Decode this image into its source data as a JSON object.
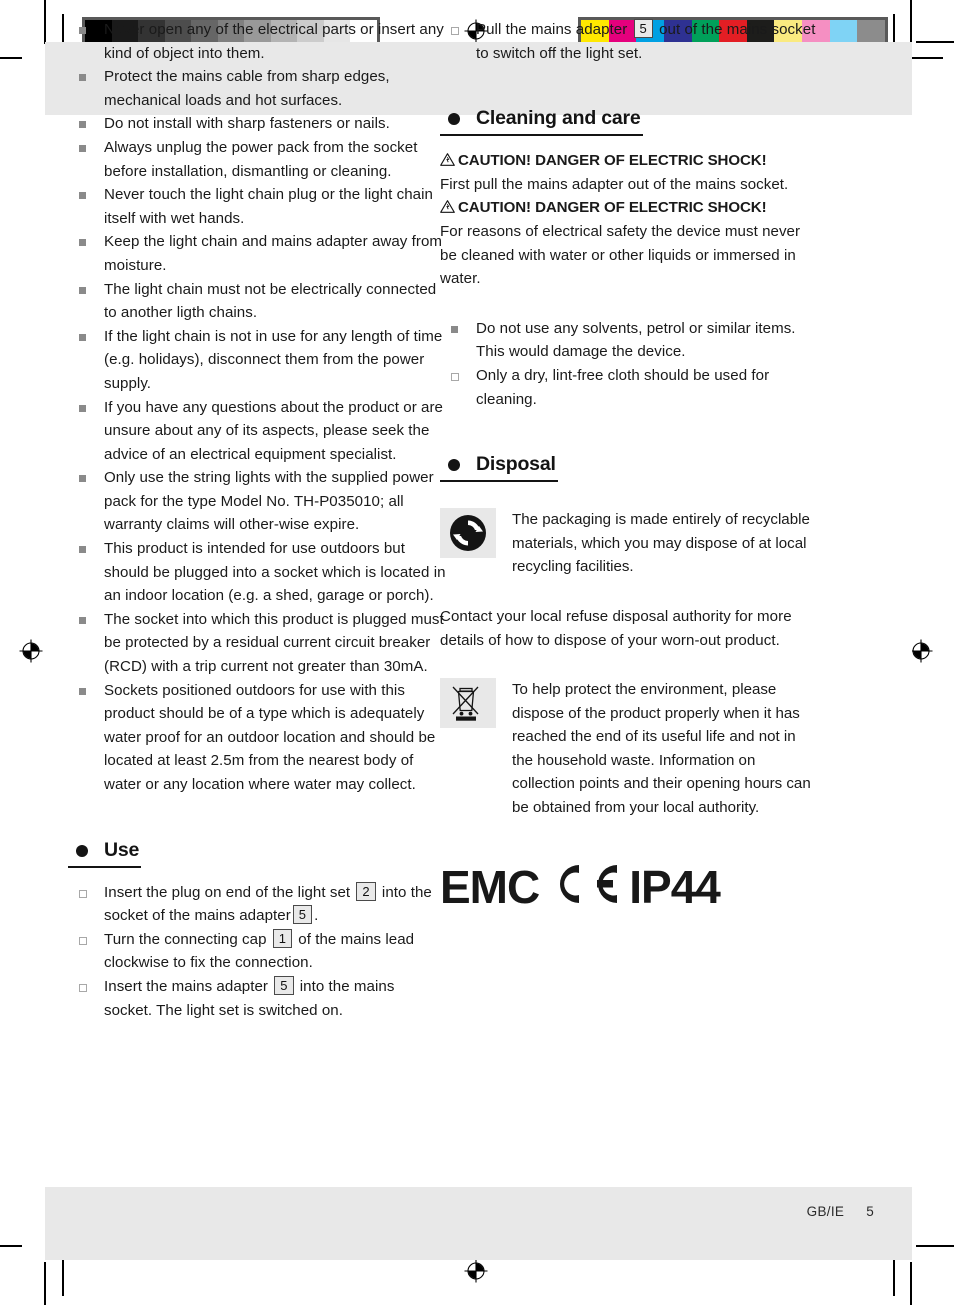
{
  "prepress": {
    "gray_strip_swatches": [
      "#000000",
      "#1a1a1a",
      "#333333",
      "#4d4d4d",
      "#666666",
      "#808080",
      "#999999",
      "#b3b3b3",
      "#cccccc",
      "#e6e6e6",
      "#ffffff"
    ],
    "color_strip_swatches": [
      "#ffe800",
      "#e5007d",
      "#00a0e3",
      "#2e3192",
      "#00a05a",
      "#e31e24",
      "#1d1d1b",
      "#faea80",
      "#f58fc2",
      "#7fd3f5",
      "#8c8c8c"
    ],
    "registration_mark_name": "registration-target"
  },
  "left_column": {
    "safety_items": [
      "Never open any of the electrical parts or insert any kind of object into them.",
      "Protect the mains cable from sharp edges, mechanical loads and hot surfaces.",
      "Do not install with sharp fasteners or nails.",
      "Always unplug the power pack from the socket before installation, dismantling or cleaning.",
      "Never touch the light chain plug or the light chain itself with wet hands.",
      "Keep the light chain and mains adapter away from moisture.",
      "The light chain must not be electrically connected to another ligth chains.",
      "If the light chain is not in use for any length of time (e.g. holidays), disconnect them from the power supply.",
      "If you have any questions about the product or are unsure about any of its aspects, please seek the advice of an electrical equipment specialist.",
      "Only use the string lights with the supplied power pack for the type Model No. TH-P035010; all warranty claims will other-wise expire.",
      "This product is intended for use outdoors but should be plugged into a socket which is located in an indoor location (e.g. a shed, garage or porch).",
      "The socket into which this product is plugged must be protected by a residual current circuit breaker (RCD) with a trip current not greater than 30mA.",
      "Sockets positioned outdoors for use with this product should be of a type which is adequately water proof for an outdoor location and should be located at least 2.5m from the nearest body of water or any location where water may collect."
    ],
    "use_heading": "Use",
    "use_steps": [
      {
        "part_a": "Insert the plug on end of the light set",
        "ref1": "2",
        "part_b": "into the socket of the mains adapter",
        "ref2": "5",
        "part_c": "."
      },
      {
        "part_a": "Turn the connecting cap",
        "ref1": "1",
        "part_b": "of the mains lead clockwise to fix the connection.",
        "ref2": "",
        "part_c": ""
      },
      {
        "part_a": "Insert the mains adapter",
        "ref1": "5",
        "part_b": "into the mains socket. The light set is switched on.",
        "ref2": "",
        "part_c": ""
      }
    ]
  },
  "right_column": {
    "top_step": {
      "part_a": "Pull the mains adapter",
      "ref1": "5",
      "part_b": "out of the mains socket to switch off the light set."
    },
    "cleaning_heading": "Cleaning and care",
    "caution_1": "CAUTION! DANGER OF ELECTRIC SHOCK!",
    "cleaning_body_1": "First pull the mains adapter out of the mains socket.",
    "caution_2": "CAUTION! DANGER OF ELECTRIC SHOCK!",
    "cleaning_body_2": "For reasons of electrical safety the device must never be cleaned with water or other liquids or immersed in water.",
    "cleaning_items": [
      {
        "bullet": "square",
        "text": "Do not use any solvents, petrol or similar items. This would damage the device."
      },
      {
        "bullet": "hollow",
        "text": "Only a dry, lint-free cloth should be used for cleaning."
      }
    ],
    "disposal_heading": "Disposal",
    "recycling_text": "The packaging is made entirely of recyclable materials, which you may dispose of at local recycling facilities.",
    "refuse_text": "Contact your local refuse disposal authority for more details of how to dispose of your worn-out product.",
    "weee_text": "To help protect the environment, please dispose of the product properly when it has reached the end of its useful life and not in the household waste. Information on collection points and their opening hours can be obtained from your local authority.",
    "markings": {
      "emc": "EMC",
      "ce": "CE",
      "ip": "IP44"
    }
  },
  "footer": {
    "locale": "GB/IE",
    "page_number": "5"
  }
}
